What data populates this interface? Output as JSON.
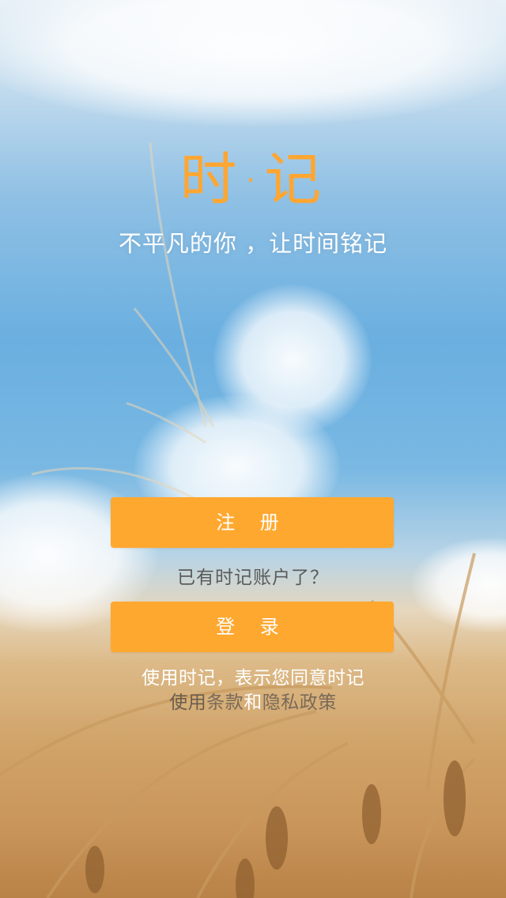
{
  "app": {
    "logo_text": "时·记",
    "tagline": "不平凡的你 ，让时间铭记"
  },
  "actions": {
    "register_label": "注 册",
    "has_account_text": "已有时记账户了？",
    "login_label": "登 录"
  },
  "terms": {
    "line1": "使用时记，表示您同意时记",
    "prefix": "使用",
    "terms_link": "条款",
    "conjunction": "和",
    "privacy_link": "隐私政策"
  },
  "colors": {
    "accent": "#ffa82f",
    "logo": "#ffa632",
    "link_text": "#6a5d4d"
  }
}
